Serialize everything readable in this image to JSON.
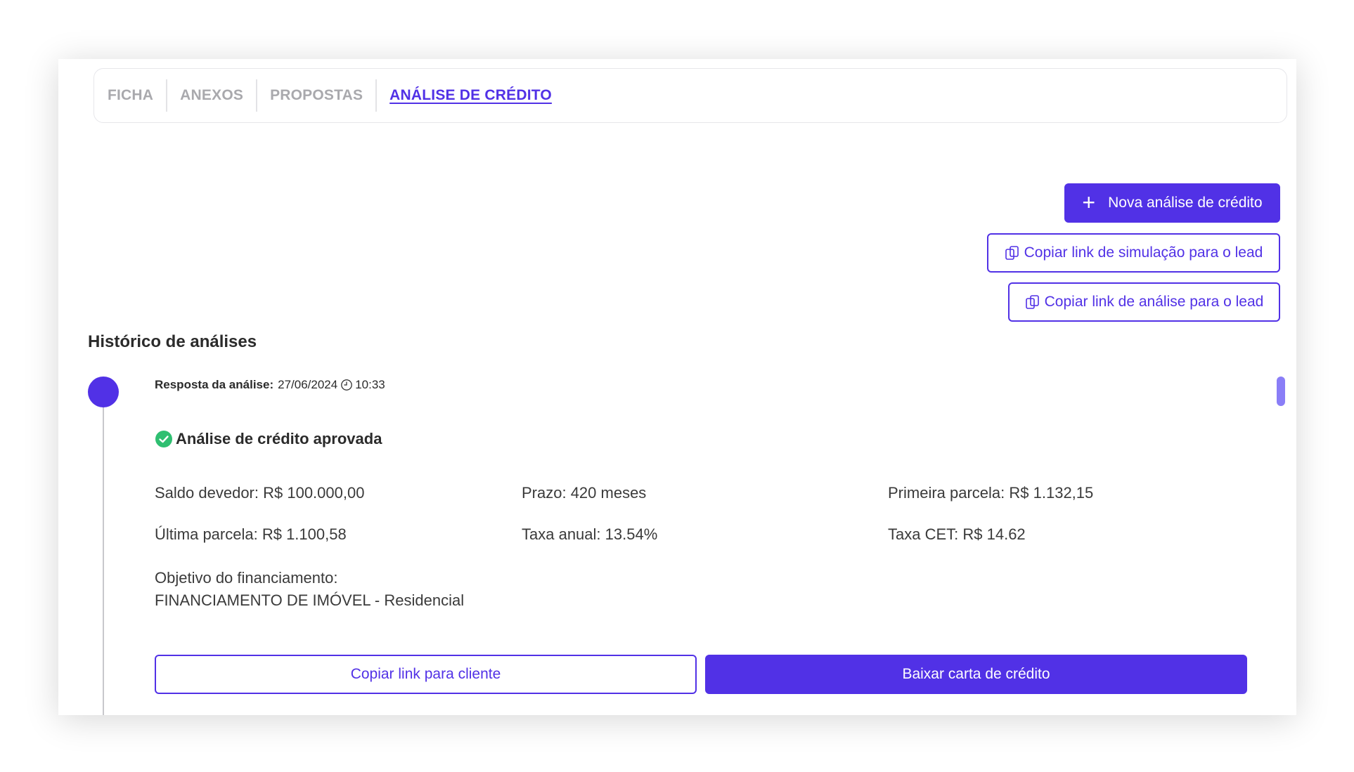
{
  "tabs": [
    {
      "label": "FICHA"
    },
    {
      "label": "ANEXOS"
    },
    {
      "label": "PROPOSTAS"
    },
    {
      "label": "ANÁLISE DE CRÉDITO",
      "active": true
    }
  ],
  "actions": {
    "new_analysis": "Nova análise de crédito",
    "copy_simulation_link": "Copiar link de simulação para o lead",
    "copy_analysis_link": "Copiar link de análise para o lead"
  },
  "history": {
    "title": "Histórico de análises",
    "entry": {
      "response_label": "Resposta da análise:",
      "date": "27/06/2024",
      "time": "10:33",
      "status": "Análise de crédito aprovada",
      "fields": {
        "saldo_devedor": "Saldo devedor: R$ 100.000,00",
        "prazo": "Prazo: 420 meses",
        "primeira_parcela": "Primeira parcela: R$ 1.132,15",
        "ultima_parcela": "Última parcela: R$ 1.100,58",
        "taxa_anual": "Taxa anual: 13.54%",
        "taxa_cet": "Taxa CET: R$ 14.62",
        "objetivo_label": "Objetivo do financiamento:",
        "objetivo_value": "FINANCIAMENTO DE IMÓVEL - Residencial"
      },
      "copy_client_link": "Copiar link para cliente",
      "download_letter": "Baixar carta de crédito"
    }
  },
  "colors": {
    "primary": "#5131e6",
    "success": "#2fbf71",
    "tab_inactive": "#a9a9ad"
  },
  "icons": [
    "plus-icon",
    "copy-icon",
    "clock-icon",
    "check-circle-icon"
  ]
}
